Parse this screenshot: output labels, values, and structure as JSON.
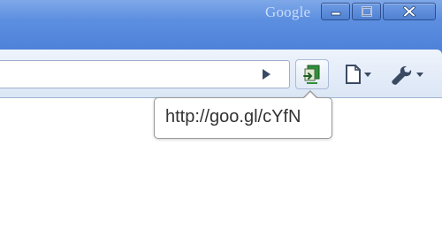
{
  "titlebar": {
    "brand": "Google",
    "colors": {
      "frame": "#5d8fe0",
      "brand_text": "#c9dcf8"
    },
    "controls": [
      {
        "name": "minimize",
        "icon": "minimize-icon"
      },
      {
        "name": "maximize",
        "icon": "maximize-icon"
      },
      {
        "name": "close",
        "icon": "close-icon"
      }
    ]
  },
  "toolbar": {
    "omnibox_value": "",
    "go_icon": "play-arrow-icon",
    "extension_icon": "url-shortener-extension-icon",
    "page_menu_icon": "page-icon",
    "wrench_menu_icon": "wrench-icon"
  },
  "tooltip": {
    "text": "http://goo.gl/cYfN"
  }
}
